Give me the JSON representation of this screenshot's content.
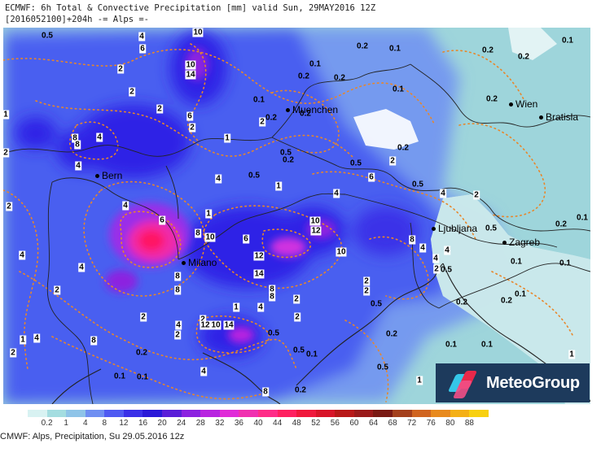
{
  "header": {
    "line1": "ECMWF: 6h Total & Convective Precipitation [mm] valid Sun, 29MAY2016 12Z",
    "line2": "[2016052100]+204h -= Alps =-"
  },
  "colors": {
    "light": "#9ed5db",
    "mid": "#4a5ff0",
    "blue": "#2e22e6",
    "purple": "#9a2ee8",
    "magenta": "#f02ca8",
    "pink": "#ff1464",
    "contour": "#e8862a",
    "border": "#222222"
  },
  "cities": [
    {
      "name": "Muenchen"
    },
    {
      "name": "Wien"
    },
    {
      "name": "Bratisla"
    },
    {
      "name": "Bern"
    },
    {
      "name": "Milano"
    },
    {
      "name": "Ljubljana"
    },
    {
      "name": "Zagreb"
    }
  ],
  "labels": [
    {
      "text": "0.5"
    },
    {
      "text": "4"
    },
    {
      "text": "6"
    },
    {
      "text": "10"
    },
    {
      "text": "0.2"
    },
    {
      "text": "0.1"
    },
    {
      "text": "0.2"
    },
    {
      "text": "0.2"
    },
    {
      "text": "0.1"
    },
    {
      "text": "2"
    },
    {
      "text": "2"
    },
    {
      "text": "10"
    },
    {
      "text": "14"
    },
    {
      "text": "0.1"
    },
    {
      "text": "0.2"
    },
    {
      "text": "0.2"
    },
    {
      "text": "2"
    },
    {
      "text": "8"
    },
    {
      "text": "6"
    },
    {
      "text": "2"
    },
    {
      "text": "0.1"
    },
    {
      "text": "0.2"
    },
    {
      "text": "0.2"
    },
    {
      "text": "0.1"
    },
    {
      "text": "0.2"
    },
    {
      "text": "1"
    },
    {
      "text": "8"
    },
    {
      "text": "4"
    },
    {
      "text": "1"
    },
    {
      "text": "2"
    },
    {
      "text": "4"
    },
    {
      "text": "0.5"
    },
    {
      "text": "0.2"
    },
    {
      "text": "0.5"
    },
    {
      "text": "6"
    },
    {
      "text": "2"
    },
    {
      "text": "0.2"
    },
    {
      "text": "2"
    },
    {
      "text": "2"
    },
    {
      "text": "4"
    },
    {
      "text": "1"
    },
    {
      "text": "0.5"
    },
    {
      "text": "1"
    },
    {
      "text": "0.5"
    },
    {
      "text": "4"
    },
    {
      "text": "2"
    },
    {
      "text": "4"
    },
    {
      "text": "4"
    },
    {
      "text": "6"
    },
    {
      "text": "8"
    },
    {
      "text": "10"
    },
    {
      "text": "6"
    },
    {
      "text": "10"
    },
    {
      "text": "12"
    },
    {
      "text": "0.5"
    },
    {
      "text": "0.2"
    },
    {
      "text": "0.1"
    },
    {
      "text": "4"
    },
    {
      "text": "4"
    },
    {
      "text": "8"
    },
    {
      "text": "12"
    },
    {
      "text": "10"
    },
    {
      "text": "4"
    },
    {
      "text": "4"
    },
    {
      "text": "4"
    },
    {
      "text": "2"
    },
    {
      "text": "0.5"
    },
    {
      "text": "0.1"
    },
    {
      "text": "0.1"
    },
    {
      "text": "14"
    },
    {
      "text": "8"
    },
    {
      "text": "8"
    },
    {
      "text": "8"
    },
    {
      "text": "8"
    },
    {
      "text": "2"
    },
    {
      "text": "2"
    },
    {
      "text": "0.5"
    },
    {
      "text": "0.2"
    },
    {
      "text": "0.1"
    },
    {
      "text": "0.2"
    },
    {
      "text": "2"
    },
    {
      "text": "4"
    },
    {
      "text": "1"
    },
    {
      "text": "2"
    },
    {
      "text": "2"
    },
    {
      "text": "4"
    },
    {
      "text": "2"
    },
    {
      "text": "12"
    },
    {
      "text": "10"
    },
    {
      "text": "14"
    },
    {
      "text": "0.5"
    },
    {
      "text": "0.2"
    },
    {
      "text": "0.1"
    },
    {
      "text": "0.1"
    },
    {
      "text": "2"
    },
    {
      "text": "4"
    },
    {
      "text": "1"
    },
    {
      "text": "8"
    },
    {
      "text": "2"
    },
    {
      "text": "2"
    },
    {
      "text": "0.5"
    },
    {
      "text": "0.1"
    },
    {
      "text": "0.2"
    },
    {
      "text": "0.5"
    },
    {
      "text": "1"
    },
    {
      "text": "4"
    },
    {
      "text": "8"
    },
    {
      "text": "0.2"
    },
    {
      "text": "0.1"
    },
    {
      "text": "0.1"
    },
    {
      "text": "1"
    }
  ],
  "logo": {
    "text": "MeteoGroup"
  },
  "colorbar": {
    "ticks": [
      "0.2",
      "1",
      "4",
      "8",
      "12",
      "16",
      "20",
      "24",
      "28",
      "32",
      "36",
      "40",
      "44",
      "48",
      "52",
      "56",
      "60",
      "64",
      "68",
      "72",
      "76",
      "80",
      "88"
    ],
    "colors": [
      "#d8f2f2",
      "#a4dde0",
      "#8fc4e8",
      "#6f8ff2",
      "#4f5af2",
      "#3a30e8",
      "#2a18d8",
      "#5a1ed8",
      "#8c22e0",
      "#b824e0",
      "#e02cd8",
      "#f030b0",
      "#ff2c88",
      "#ff2060",
      "#f0183c",
      "#d81428",
      "#b81818",
      "#9a1a1a",
      "#7a1a14",
      "#a4401c",
      "#d06420",
      "#e88a1e",
      "#f4b016",
      "#f8d010"
    ]
  },
  "footer": "CMWF: Alps, Precipitation, Su 29.05.2016 12z"
}
